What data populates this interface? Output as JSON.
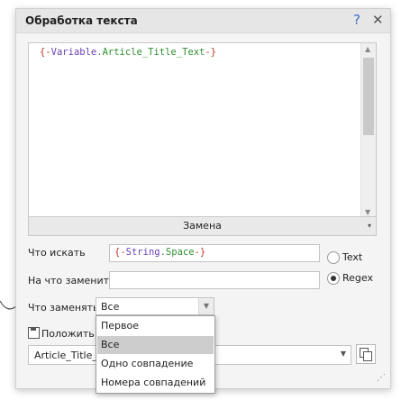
{
  "dialog": {
    "title": "Обработка текста",
    "help_icon": "?",
    "close_icon": "✕"
  },
  "editor": {
    "tokens": [
      "{-",
      "Variable",
      ".",
      "Article_Title_Text",
      "-}"
    ]
  },
  "mode": {
    "value": "Замена",
    "arrow": "▾"
  },
  "fields": {
    "find_label": "Что искать",
    "find_tokens": [
      "{-",
      "String",
      ".",
      "Space",
      "-}"
    ],
    "replace_label": "На что заменить",
    "replace_value": "",
    "what_label": "Что заменять",
    "what_value": "Все",
    "text_radio": "Text",
    "regex_radio": "Regex",
    "selected_radio": "Regex"
  },
  "save": {
    "label_visible": "Положить р",
    "result_visible": "Article_Title_Te"
  },
  "dropdown": {
    "options": [
      "Первое",
      "Все",
      "Одно совпадение",
      "Номера совпадений"
    ],
    "selected": "Все"
  },
  "icons": {
    "save": "floppy-disk-icon",
    "copy": "copy-icon",
    "help": "help-icon",
    "close": "close-icon"
  }
}
